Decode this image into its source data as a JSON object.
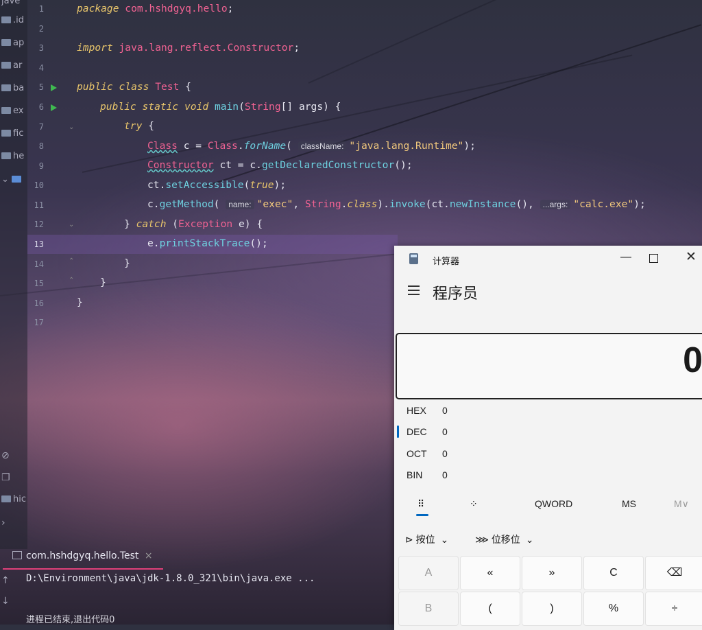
{
  "project": {
    "items": [
      "jave",
      ".id",
      "ap",
      "ar",
      "ba",
      "ex",
      "fic",
      "he",
      "hic"
    ]
  },
  "editor": {
    "line_numbers": [
      "1",
      "2",
      "3",
      "4",
      "5",
      "6",
      "7",
      "8",
      "9",
      "10",
      "11",
      "12",
      "13",
      "14",
      "15",
      "16",
      "17"
    ],
    "code": {
      "l1_kw": "package",
      "l1_pkg": " com.hshdgyq.hello",
      "l1_end": ";",
      "l3_kw": "import",
      "l3_pkg": " java.lang.reflect.Constructor",
      "l3_end": ";",
      "l5_kw": "public class",
      "l5_ty": "Test",
      "l5_end": " {",
      "l6_kw": "public static void",
      "l6_fn": "main",
      "l6_a": "(",
      "l6_ty": "String",
      "l6_b": "[] args) {",
      "l7_kw": "try",
      "l7_end": " {",
      "l8_ty1": "Class",
      "l8_a": " c = ",
      "l8_ty2": "Class",
      "l8_b": ".",
      "l8_fn": "forName",
      "l8_c": "(",
      "l8_hint": "className:",
      "l8_str": "\"java.lang.Runtime\"",
      "l8_end": ");",
      "l9_ty": "Constructor",
      "l9_a": " ct = c.",
      "l9_fn": "getDeclaredConstructor",
      "l9_end": "();",
      "l10_a": "ct.",
      "l10_fn": "setAccessible",
      "l10_b": "(",
      "l10_kw": "true",
      "l10_end": ");",
      "l11_a": "c.",
      "l11_fn": "getMethod",
      "l11_b": "(",
      "l11_hint1": "name:",
      "l11_str1": "\"exec\"",
      "l11_c": ", ",
      "l11_ty": "String",
      "l11_d": ".",
      "l11_kw": "class",
      "l11_e": ").",
      "l11_fn2": "invoke",
      "l11_f": "(ct.",
      "l11_fn3": "newInstance",
      "l11_g": "(), ",
      "l11_hint2": "...args:",
      "l11_str2": "\"calc.exe\"",
      "l11_end": ");",
      "l12_a": "} ",
      "l12_kw": "catch",
      "l12_b": " (",
      "l12_ty": "Exception",
      "l12_end": " e) {",
      "l13_a": "e.",
      "l13_fn": "printStackTrace",
      "l13_end": "();",
      "l14": "}",
      "l15": "}",
      "l16": "}"
    }
  },
  "run_panel": {
    "tab_label": "com.hshdgyq.hello.Test",
    "command": "D:\\Environment\\java\\jdk-1.8.0_321\\bin\\java.exe ...",
    "exit_message": "进程已结束,退出代码0"
  },
  "calculator": {
    "title": "计算器",
    "mode": "程序员",
    "display": "0",
    "radix": [
      {
        "label": "HEX",
        "value": "0"
      },
      {
        "label": "DEC",
        "value": "0"
      },
      {
        "label": "OCT",
        "value": "0"
      },
      {
        "label": "BIN",
        "value": "0"
      }
    ],
    "word_size": "QWORD",
    "ms_label": "MS",
    "mv_label": "M∨",
    "bitwise_label": "按位",
    "bitshift_label": "位移位",
    "keys_row1": [
      "A",
      "«",
      "»",
      "C",
      "⌫"
    ],
    "keys_row2": [
      "B",
      "(",
      ")",
      "%",
      "÷"
    ],
    "accent_color": "#0067c0"
  }
}
